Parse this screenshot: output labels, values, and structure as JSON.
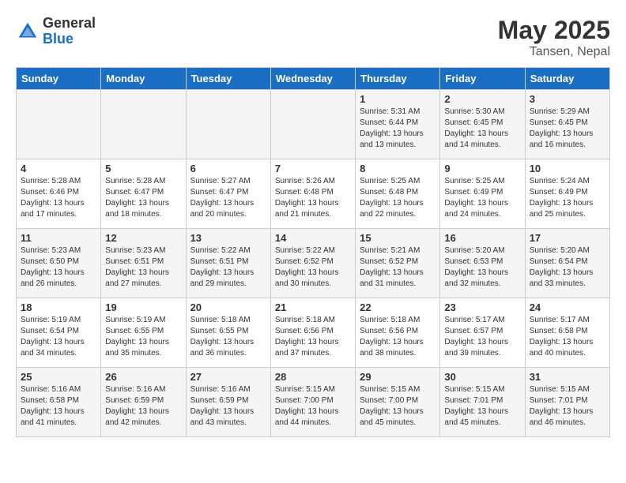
{
  "header": {
    "logo_general": "General",
    "logo_blue": "Blue",
    "month_year": "May 2025",
    "location": "Tansen, Nepal"
  },
  "days_of_week": [
    "Sunday",
    "Monday",
    "Tuesday",
    "Wednesday",
    "Thursday",
    "Friday",
    "Saturday"
  ],
  "weeks": [
    [
      {
        "day": "",
        "info": ""
      },
      {
        "day": "",
        "info": ""
      },
      {
        "day": "",
        "info": ""
      },
      {
        "day": "",
        "info": ""
      },
      {
        "day": "1",
        "info": "Sunrise: 5:31 AM\nSunset: 6:44 PM\nDaylight: 13 hours\nand 13 minutes."
      },
      {
        "day": "2",
        "info": "Sunrise: 5:30 AM\nSunset: 6:45 PM\nDaylight: 13 hours\nand 14 minutes."
      },
      {
        "day": "3",
        "info": "Sunrise: 5:29 AM\nSunset: 6:45 PM\nDaylight: 13 hours\nand 16 minutes."
      }
    ],
    [
      {
        "day": "4",
        "info": "Sunrise: 5:28 AM\nSunset: 6:46 PM\nDaylight: 13 hours\nand 17 minutes."
      },
      {
        "day": "5",
        "info": "Sunrise: 5:28 AM\nSunset: 6:47 PM\nDaylight: 13 hours\nand 18 minutes."
      },
      {
        "day": "6",
        "info": "Sunrise: 5:27 AM\nSunset: 6:47 PM\nDaylight: 13 hours\nand 20 minutes."
      },
      {
        "day": "7",
        "info": "Sunrise: 5:26 AM\nSunset: 6:48 PM\nDaylight: 13 hours\nand 21 minutes."
      },
      {
        "day": "8",
        "info": "Sunrise: 5:25 AM\nSunset: 6:48 PM\nDaylight: 13 hours\nand 22 minutes."
      },
      {
        "day": "9",
        "info": "Sunrise: 5:25 AM\nSunset: 6:49 PM\nDaylight: 13 hours\nand 24 minutes."
      },
      {
        "day": "10",
        "info": "Sunrise: 5:24 AM\nSunset: 6:49 PM\nDaylight: 13 hours\nand 25 minutes."
      }
    ],
    [
      {
        "day": "11",
        "info": "Sunrise: 5:23 AM\nSunset: 6:50 PM\nDaylight: 13 hours\nand 26 minutes."
      },
      {
        "day": "12",
        "info": "Sunrise: 5:23 AM\nSunset: 6:51 PM\nDaylight: 13 hours\nand 27 minutes."
      },
      {
        "day": "13",
        "info": "Sunrise: 5:22 AM\nSunset: 6:51 PM\nDaylight: 13 hours\nand 29 minutes."
      },
      {
        "day": "14",
        "info": "Sunrise: 5:22 AM\nSunset: 6:52 PM\nDaylight: 13 hours\nand 30 minutes."
      },
      {
        "day": "15",
        "info": "Sunrise: 5:21 AM\nSunset: 6:52 PM\nDaylight: 13 hours\nand 31 minutes."
      },
      {
        "day": "16",
        "info": "Sunrise: 5:20 AM\nSunset: 6:53 PM\nDaylight: 13 hours\nand 32 minutes."
      },
      {
        "day": "17",
        "info": "Sunrise: 5:20 AM\nSunset: 6:54 PM\nDaylight: 13 hours\nand 33 minutes."
      }
    ],
    [
      {
        "day": "18",
        "info": "Sunrise: 5:19 AM\nSunset: 6:54 PM\nDaylight: 13 hours\nand 34 minutes."
      },
      {
        "day": "19",
        "info": "Sunrise: 5:19 AM\nSunset: 6:55 PM\nDaylight: 13 hours\nand 35 minutes."
      },
      {
        "day": "20",
        "info": "Sunrise: 5:18 AM\nSunset: 6:55 PM\nDaylight: 13 hours\nand 36 minutes."
      },
      {
        "day": "21",
        "info": "Sunrise: 5:18 AM\nSunset: 6:56 PM\nDaylight: 13 hours\nand 37 minutes."
      },
      {
        "day": "22",
        "info": "Sunrise: 5:18 AM\nSunset: 6:56 PM\nDaylight: 13 hours\nand 38 minutes."
      },
      {
        "day": "23",
        "info": "Sunrise: 5:17 AM\nSunset: 6:57 PM\nDaylight: 13 hours\nand 39 minutes."
      },
      {
        "day": "24",
        "info": "Sunrise: 5:17 AM\nSunset: 6:58 PM\nDaylight: 13 hours\nand 40 minutes."
      }
    ],
    [
      {
        "day": "25",
        "info": "Sunrise: 5:16 AM\nSunset: 6:58 PM\nDaylight: 13 hours\nand 41 minutes."
      },
      {
        "day": "26",
        "info": "Sunrise: 5:16 AM\nSunset: 6:59 PM\nDaylight: 13 hours\nand 42 minutes."
      },
      {
        "day": "27",
        "info": "Sunrise: 5:16 AM\nSunset: 6:59 PM\nDaylight: 13 hours\nand 43 minutes."
      },
      {
        "day": "28",
        "info": "Sunrise: 5:15 AM\nSunset: 7:00 PM\nDaylight: 13 hours\nand 44 minutes."
      },
      {
        "day": "29",
        "info": "Sunrise: 5:15 AM\nSunset: 7:00 PM\nDaylight: 13 hours\nand 45 minutes."
      },
      {
        "day": "30",
        "info": "Sunrise: 5:15 AM\nSunset: 7:01 PM\nDaylight: 13 hours\nand 45 minutes."
      },
      {
        "day": "31",
        "info": "Sunrise: 5:15 AM\nSunset: 7:01 PM\nDaylight: 13 hours\nand 46 minutes."
      }
    ]
  ]
}
